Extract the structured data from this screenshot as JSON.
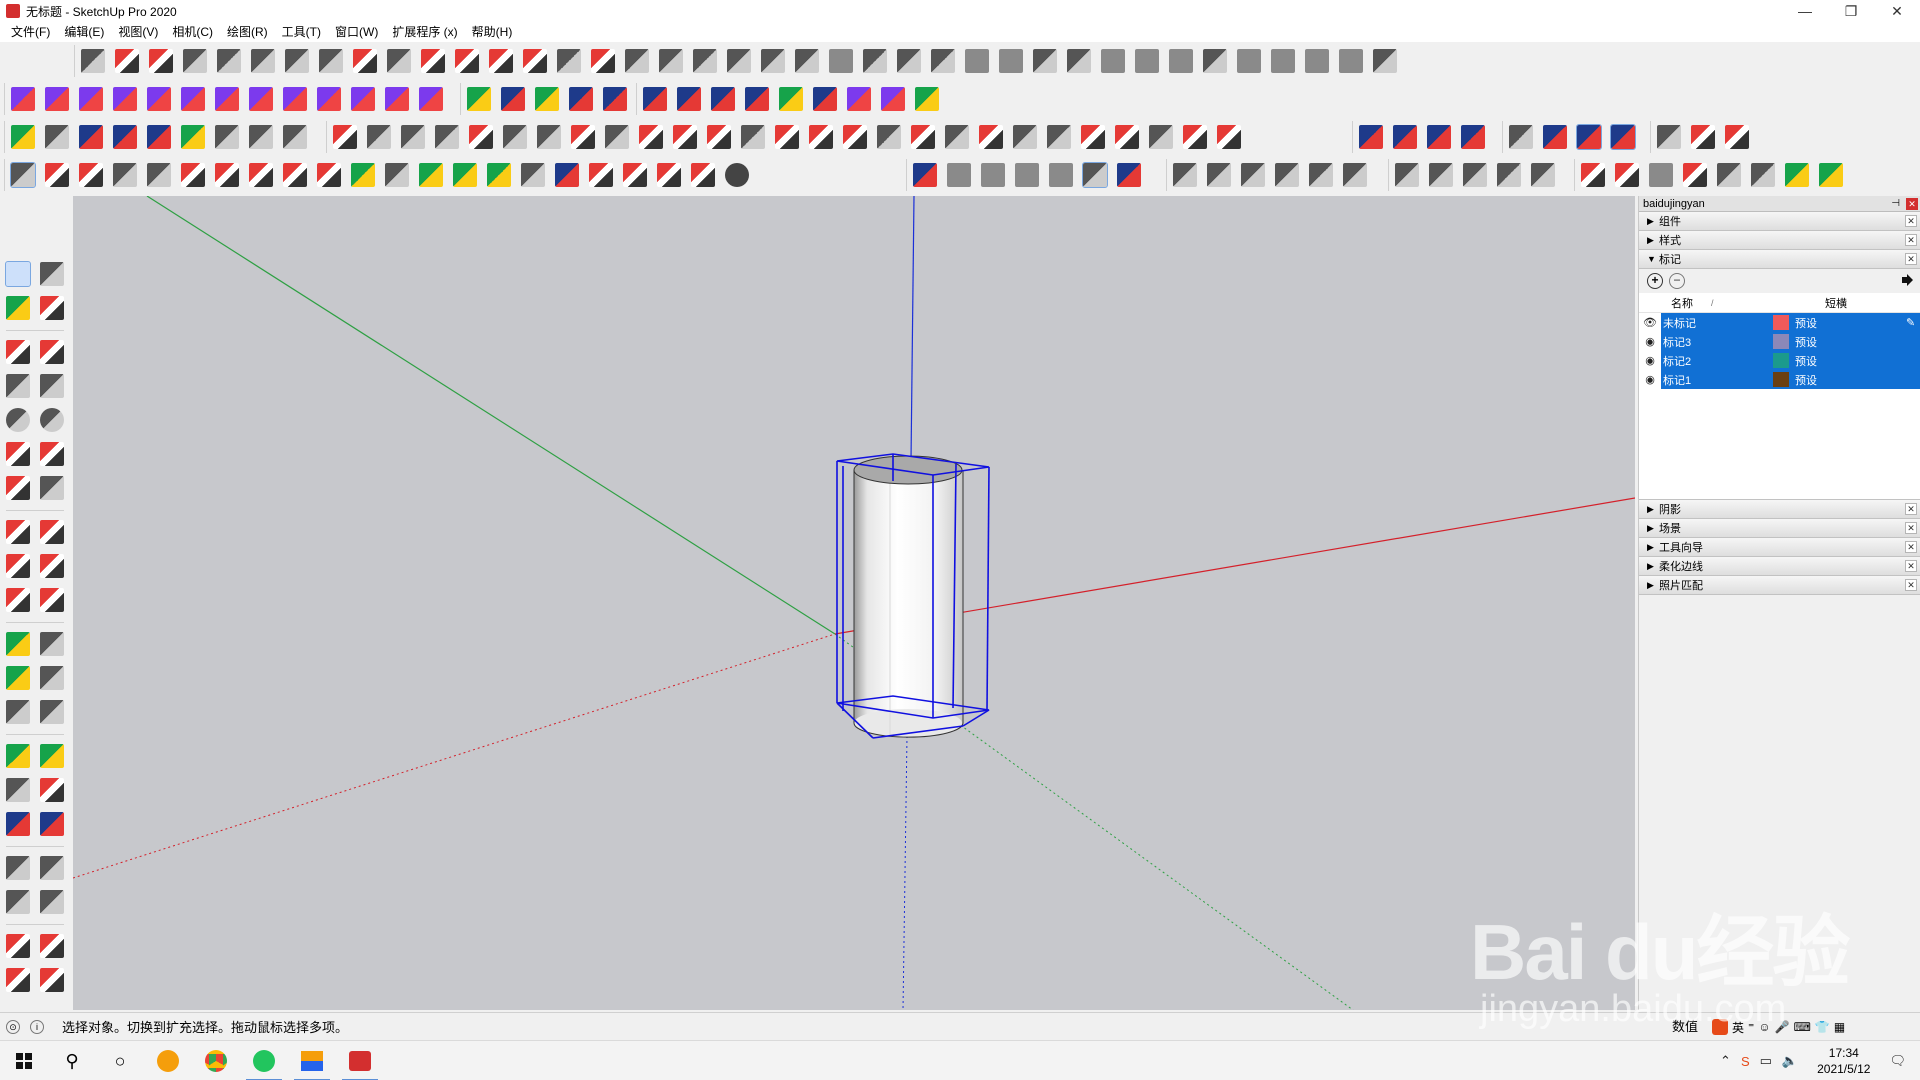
{
  "window": {
    "title": "无标题 - SketchUp Pro 2020",
    "minimize": "—",
    "restore": "❐",
    "close": "✕"
  },
  "menu": [
    "文件(F)",
    "编辑(E)",
    "视图(V)",
    "相机(C)",
    "绘图(R)",
    "工具(T)",
    "窗口(W)",
    "扩展程序 (x)",
    "帮助(H)"
  ],
  "tray": {
    "title": "baidujingyan",
    "panels_top": [
      {
        "label": "组件",
        "expanded": false
      },
      {
        "label": "样式",
        "expanded": false
      },
      {
        "label": "标记",
        "expanded": true
      }
    ],
    "tags": {
      "col_name": "名称",
      "col_dash": "短横",
      "rows": [
        {
          "name": "未标记",
          "color": "#f05a5a",
          "dash": "预设",
          "visible": true
        },
        {
          "name": "标记3",
          "color": "#8c88b8",
          "dash": "预设",
          "visible": true
        },
        {
          "name": "标记2",
          "color": "#1b9a8c",
          "dash": "预设",
          "visible": true
        },
        {
          "name": "标记1",
          "color": "#6a3f12",
          "dash": "预设",
          "visible": true
        }
      ]
    },
    "panels_bottom": [
      {
        "label": "阴影"
      },
      {
        "label": "场景"
      },
      {
        "label": "工具向导"
      },
      {
        "label": "柔化边线"
      },
      {
        "label": "照片匹配"
      }
    ]
  },
  "status": {
    "hint": "选择对象。切换到扩充选择。拖动鼠标选择多项。",
    "measure_label": "数值"
  },
  "taskbar": {
    "time": "17:34",
    "date": "2021/5/12",
    "ime_lang": "英"
  },
  "watermark": {
    "main": "Bai du经验",
    "sub": "jingyan.baidu.com"
  },
  "colors": {
    "selection": "#1170d4",
    "axis_red": "#d4202a",
    "axis_green": "#2ea043",
    "axis_blue": "#1a2fd8",
    "bbox": "#1010e0"
  }
}
